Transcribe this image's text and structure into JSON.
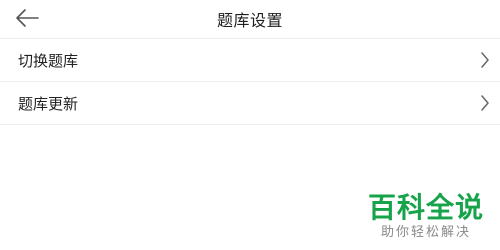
{
  "header": {
    "title": "题库设置",
    "back_icon": "arrow-left-icon"
  },
  "settings": {
    "items": [
      {
        "label": "切换题库",
        "icon": "chevron-right-icon"
      },
      {
        "label": "题库更新",
        "icon": "chevron-right-icon"
      }
    ]
  },
  "watermark": {
    "title": "百科全说",
    "subtitle": "助你轻松解决",
    "color": "#16a34a"
  }
}
